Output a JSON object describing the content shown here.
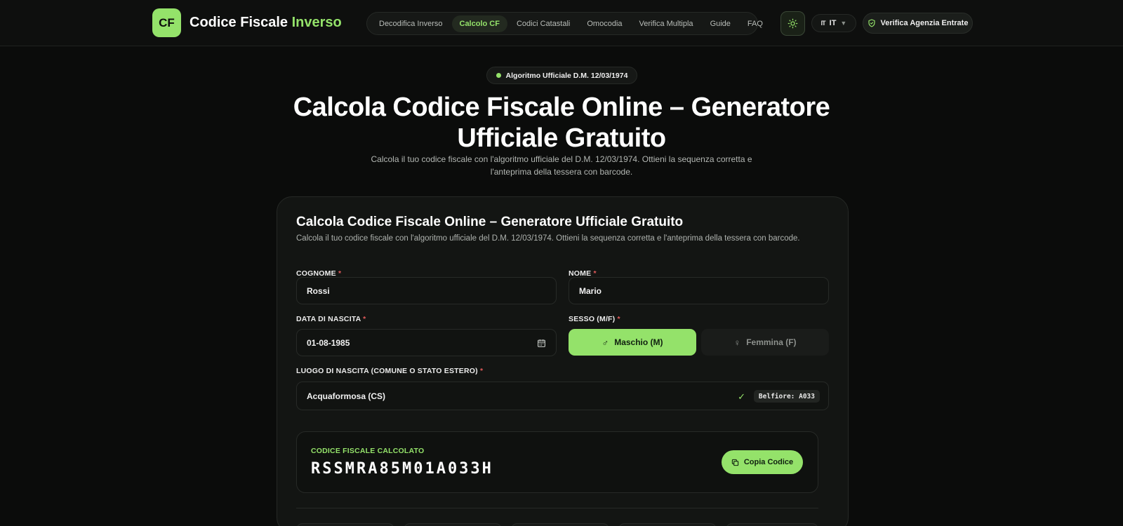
{
  "header": {
    "logo_badge": "CF",
    "brand_main": "Codice Fiscale",
    "brand_accent": "Inverso",
    "nav": [
      {
        "label": "Decodifica Inverso",
        "active": false
      },
      {
        "label": "Calcolo CF",
        "active": true
      },
      {
        "label": "Codici Catastali",
        "active": false
      },
      {
        "label": "Omocodia",
        "active": false
      },
      {
        "label": "Verifica Multipla",
        "active": false
      },
      {
        "label": "Guide",
        "active": false
      },
      {
        "label": "FAQ",
        "active": false
      }
    ],
    "theme_icon": "sun-icon",
    "lang_flag": "IT",
    "lang_code": "IT",
    "verify_label": "Verifica Agenzia Entrate"
  },
  "hero": {
    "badge": "Algoritmo Ufficiale D.M. 12/03/1974",
    "title": "Calcola Codice Fiscale Online – Generatore Ufficiale Gratuito",
    "subtitle": "Calcola il tuo codice fiscale con l'algoritmo ufficiale del D.M. 12/03/1974. Ottieni la sequenza corretta e l'anteprima della tessera con barcode."
  },
  "form": {
    "title": "Calcola Codice Fiscale Online – Generatore Ufficiale Gratuito",
    "subtitle": "Calcola il tuo codice fiscale con l'algoritmo ufficiale del D.M. 12/03/1974. Ottieni la sequenza corretta e l'anteprima della tessera con barcode.",
    "required_mark": "*",
    "cognome": {
      "label": "COGNOME",
      "value": "Rossi"
    },
    "nome": {
      "label": "NOME",
      "value": "Mario"
    },
    "data_nascita": {
      "label": "DATA DI NASCITA",
      "value": "01-08-1985"
    },
    "sesso": {
      "label": "SESSO (M/F)",
      "male": "Maschio (M)",
      "female": "Femmina (F)",
      "selected": "M"
    },
    "luogo": {
      "label": "LUOGO DI NASCITA (COMUNE O STATO ESTERO)",
      "value": "Acquaformosa (CS)",
      "belfiore": "Belfiore: A033"
    }
  },
  "result": {
    "label": "CODICE FISCALE CALCOLATO",
    "code": "RSSMRA85M01A033H",
    "copy_label": "Copia Codice"
  },
  "colors": {
    "accent": "#94e26a",
    "background": "#0b0c0b",
    "card": "#131513",
    "required": "#e05a5a"
  }
}
